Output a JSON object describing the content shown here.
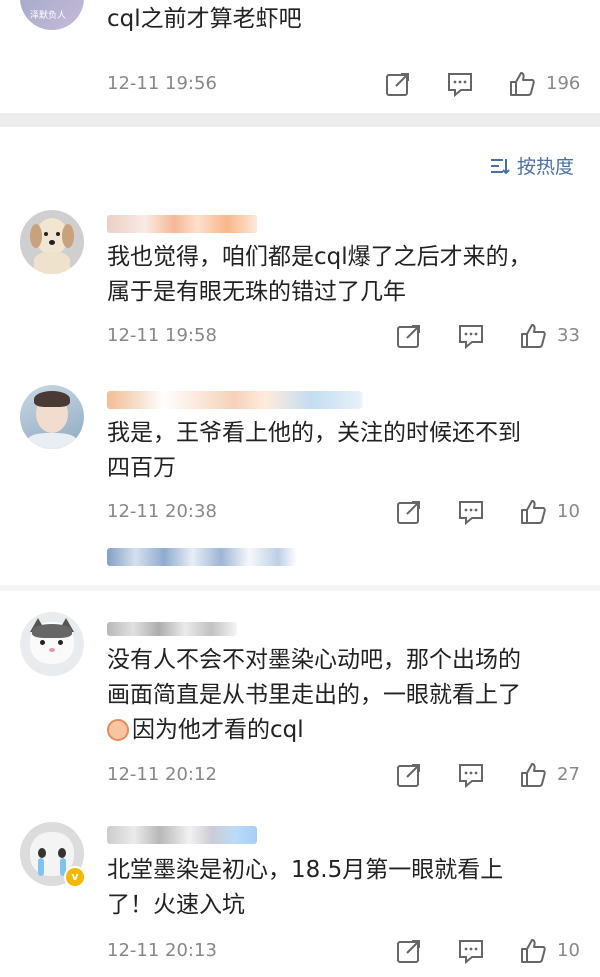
{
  "top": {
    "text": "cql之前才算老虾吧",
    "avatar_text": "泽默负人",
    "time": "12-11 19:56",
    "likes": "196"
  },
  "sort": {
    "icon": "sort-lines-icon",
    "label": "按热度"
  },
  "comments": [
    {
      "lines": [
        "我也觉得，咱们都是cql爆了之后才来的，",
        "属于是有眼无珠的错过了几年"
      ],
      "time": "12-11 19:58",
      "likes": "33",
      "avatar": "dog-avatar"
    },
    {
      "lines": [
        "我是，王爷看上他的，关注的时候还不到",
        "四百万"
      ],
      "time": "12-11 20:38",
      "likes": "10",
      "avatar": "boy-avatar"
    },
    {
      "lines": [
        "没有人不会不对墨染心动吧，那个出场的",
        "画面简直是从书里走出的，一眼就看上了",
        "因为他才看的cql"
      ],
      "time": "12-11 20:12",
      "likes": "27",
      "avatar": "cat-avatar"
    },
    {
      "lines": [
        "北堂墨染是初心，18.5月第一眼就看上",
        "了！火速入坑"
      ],
      "time": "12-11 20:13",
      "likes": "10",
      "avatar": "crying-cat-avatar"
    }
  ],
  "colors": {
    "link": "#4a6fa5",
    "meta": "#888888",
    "separator": "#ededed"
  }
}
